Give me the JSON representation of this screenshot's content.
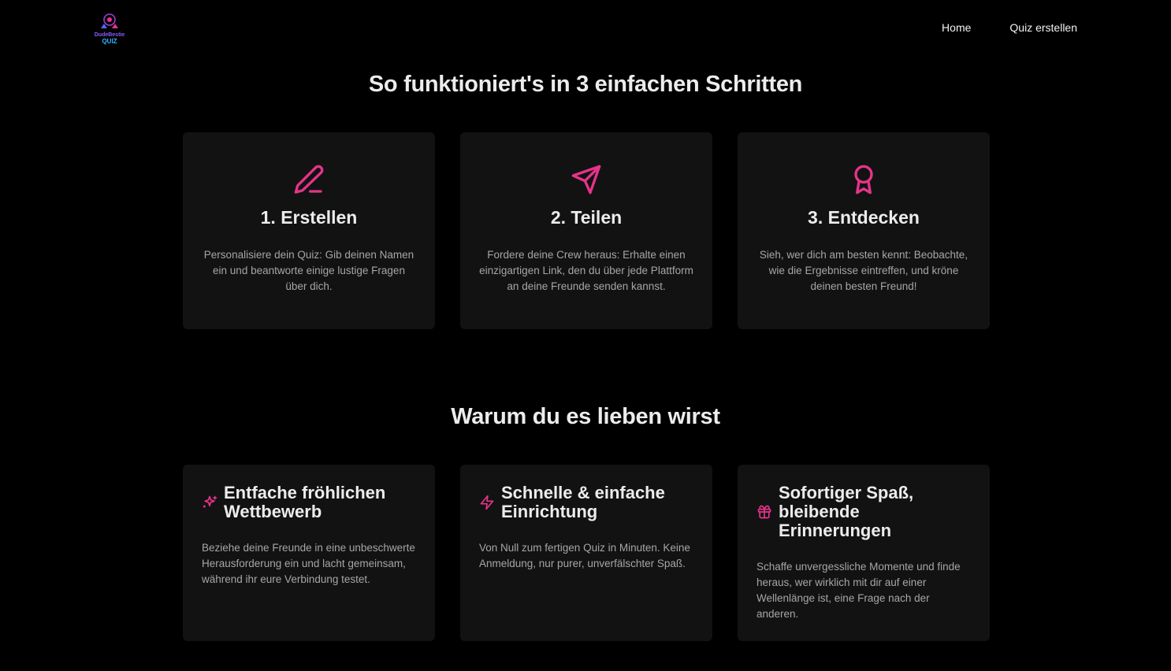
{
  "header": {
    "logo_top": "DudeBestie",
    "logo_bottom": "QUIZ",
    "nav": [
      {
        "label": "Home"
      },
      {
        "label": "Quiz erstellen"
      }
    ]
  },
  "steps": {
    "title": "So funktioniert's in 3 einfachen Schritten",
    "items": [
      {
        "icon": "pencil-icon",
        "title": "1. Erstellen",
        "text": "Personalisiere dein Quiz: Gib deinen Namen ein und beantworte einige lustige Fragen über dich."
      },
      {
        "icon": "send-icon",
        "title": "2. Teilen",
        "text": "Fordere deine Crew heraus: Erhalte einen einzigartigen Link, den du über jede Plattform an deine Freunde senden kannst."
      },
      {
        "icon": "award-icon",
        "title": "3. Entdecken",
        "text": "Sieh, wer dich am besten kennt: Beobachte, wie die Ergebnisse eintreffen, und kröne deinen besten Freund!"
      }
    ]
  },
  "features": {
    "title": "Warum du es lieben wirst",
    "items": [
      {
        "icon": "sparkles-icon",
        "title": "Entfache fröhlichen Wettbewerb",
        "text": "Beziehe deine Freunde in eine unbeschwerte Herausforderung ein und lacht gemeinsam, während ihr eure Verbindung testet."
      },
      {
        "icon": "zap-icon",
        "title": "Schnelle & einfache Einrichtung",
        "text": "Von Null zum fertigen Quiz in Minuten. Keine Anmeldung, nur purer, unverfälschter Spaß."
      },
      {
        "icon": "gift-icon",
        "title": "Sofortiger Spaß, bleibende Erinnerungen",
        "text": "Schaffe unvergessliche Momente und finde heraus, wer wirklich mit dir auf einer Wellenlänge ist, eine Frage nach der anderen."
      }
    ]
  },
  "colors": {
    "background": "#000000",
    "card": "#121212",
    "accent": "#e6338a",
    "text": "#ececec",
    "muted": "#a6a6a6"
  }
}
